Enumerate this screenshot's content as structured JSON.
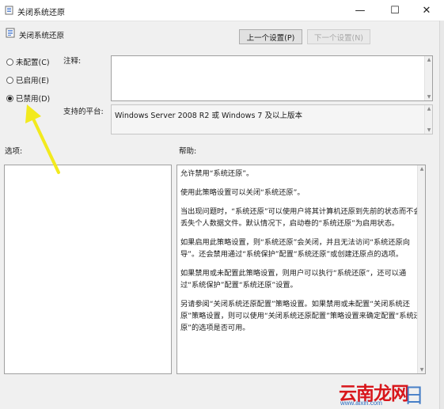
{
  "window": {
    "title": "关闭系统还原",
    "minimize": "—",
    "maximize": "☐",
    "close": "✕"
  },
  "header": {
    "policy_name": "关闭系统还原",
    "prev_button": "上一个设置(P)",
    "next_button": "下一个设置(N)"
  },
  "options": {
    "not_configured": "未配置(C)",
    "enabled": "已启用(E)",
    "disabled": "已禁用(D)",
    "selected": "disabled"
  },
  "comment": {
    "label": "注释:",
    "value": ""
  },
  "platform": {
    "label": "支持的平台:",
    "value": "Windows Server 2008 R2 或 Windows 7 及以上版本"
  },
  "sections": {
    "options_label": "选项:",
    "help_label": "帮助:"
  },
  "help": {
    "paragraphs": [
      "允许禁用“系统还原”。",
      "使用此策略设置可以关闭“系统还原”。",
      "当出现问题时，“系统还原”可以使用户将其计算机还原到先前的状态而不会丢失个人数据文件。默认情况下，启动卷的“系统还原”为启用状态。",
      "如果启用此策略设置，则“系统还原”会关闭，并且无法访问“系统还原向导”。还会禁用通过“系统保护”配置“系统还原”或创建还原点的选项。",
      "如果禁用或未配置此策略设置，则用户可以执行“系统还原”，还可以通过“系统保护”配置“系统还原”设置。",
      "另请参阅“关闭系统还原配置”策略设置。如果禁用或未配置“关闭系统还原”策略设置，则可以使用“关闭系统还原配置”策略设置来确定配置“系统还原”的选项是否可用。"
    ]
  },
  "watermark": {
    "brand": "云南龙网",
    "url": "www.aixiri.com",
    "char": "日"
  },
  "colors": {
    "arrow": "#f2ea1e",
    "watermark_red": "#d8161b",
    "watermark_blue": "#2a6cc0"
  }
}
